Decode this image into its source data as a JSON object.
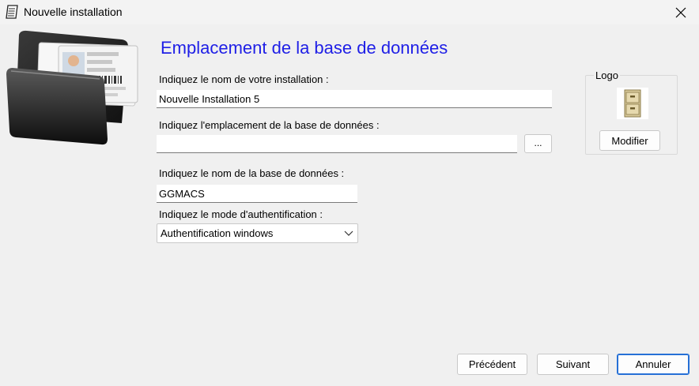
{
  "window": {
    "title": "Nouvelle installation",
    "close_icon": "close-icon"
  },
  "heading": "Emplacement de la base de données",
  "form": {
    "install_name": {
      "label": "Indiquez le nom de votre installation :",
      "value": "Nouvelle Installation 5"
    },
    "db_location": {
      "label": "Indiquez l'emplacement de la base de données :",
      "value": "",
      "browse_label": "..."
    },
    "db_name": {
      "label": "Indiquez le nom de la base de données :",
      "value": "GGMACS"
    },
    "auth_mode": {
      "label": "Indiquez le mode d'authentification :",
      "selected": "Authentification windows"
    }
  },
  "logo": {
    "legend": "Logo",
    "icon": "file-cabinet-icon",
    "modify_label": "Modifier"
  },
  "footer": {
    "previous_label": "Précédent",
    "next_label": "Suivant",
    "cancel_label": "Annuler"
  },
  "colors": {
    "heading": "#1f1fe6",
    "background": "#f0f0f0",
    "primary_border": "#2670d6"
  }
}
